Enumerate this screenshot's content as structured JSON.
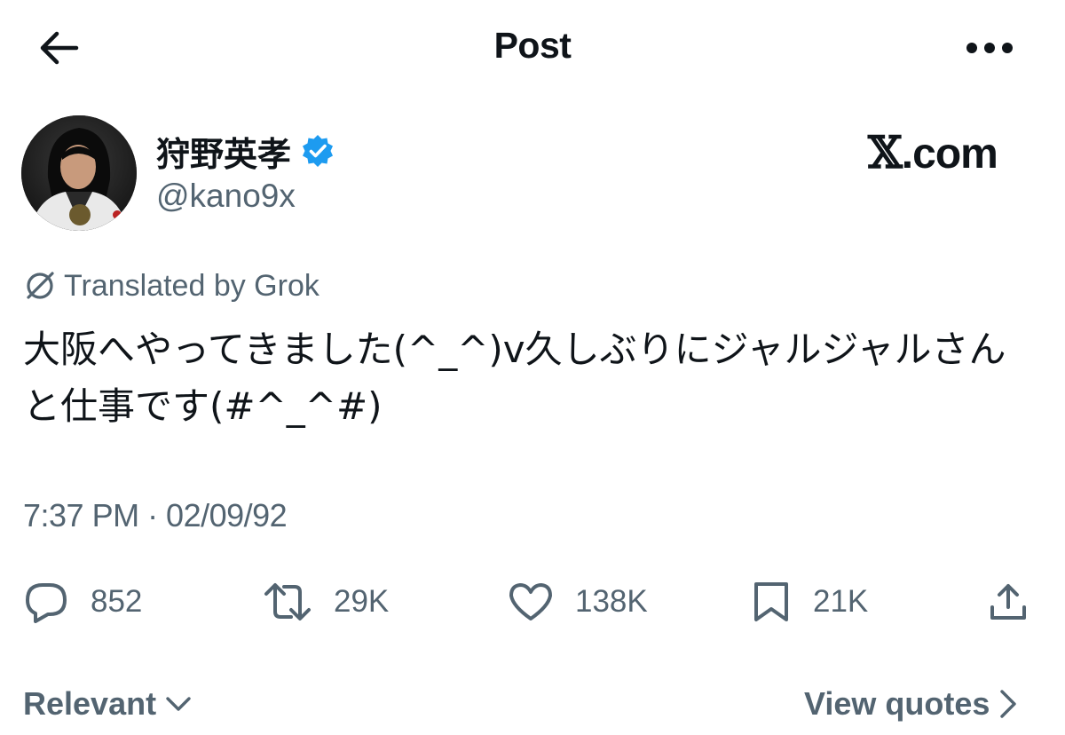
{
  "header": {
    "title": "Post",
    "back_icon": "arrow-left-icon",
    "more_icon": "more-horizontal-icon"
  },
  "author": {
    "display_name": "狩野英孝",
    "handle": "@kano9x",
    "verified": true,
    "verified_color": "#1d9bf0"
  },
  "brand": {
    "x_glyph": "𝕏",
    "suffix": ".com"
  },
  "translation": {
    "label": "Translated by Grok",
    "icon": "grok-icon"
  },
  "tweet": {
    "text": "大阪へやってきました(^_^)v久しぶりにジャルジャルさんと仕事です(#^_^#)",
    "timestamp": "7:37 PM · 02/09/92"
  },
  "actions": {
    "reply_count": "852",
    "repost_count": "29K",
    "like_count": "138K",
    "bookmark_count": "21K"
  },
  "footer": {
    "sort_label": "Relevant",
    "view_quotes_label": "View quotes"
  },
  "colors": {
    "text_primary": "#0f1419",
    "text_secondary": "#536471",
    "accent": "#1d9bf0"
  }
}
